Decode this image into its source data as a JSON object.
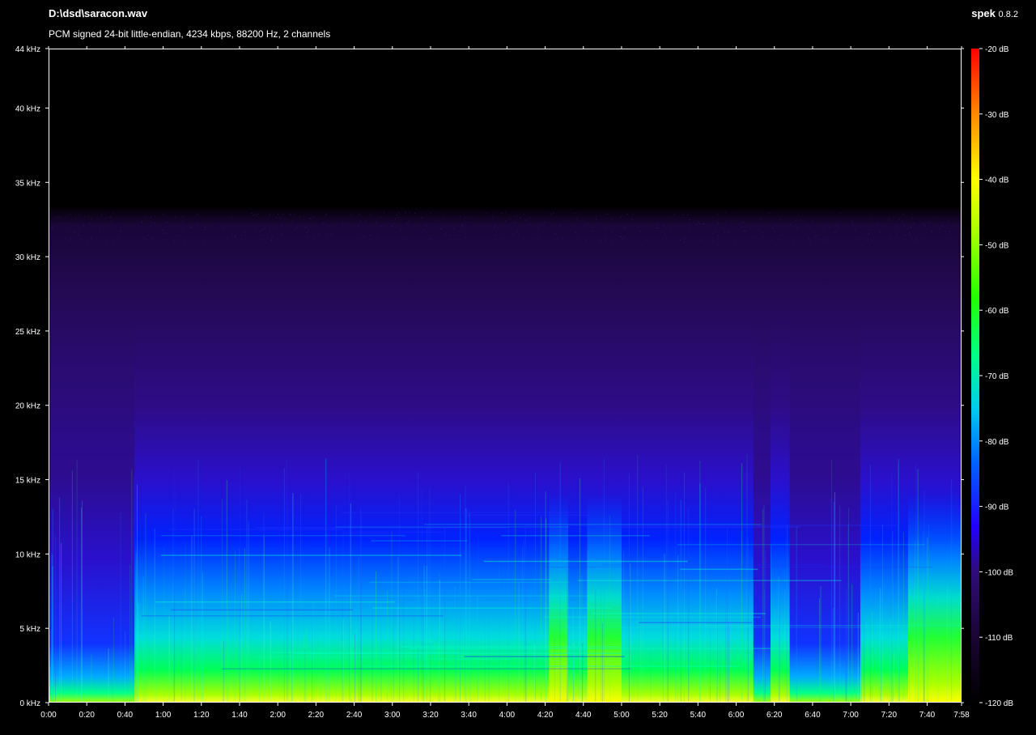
{
  "header": {
    "file_path": "D:\\dsd\\saracon.wav",
    "file_info": "PCM signed 24-bit little-endian, 4234 kbps, 88200 Hz, 2 channels",
    "app_name": "spek",
    "app_version": "0.8.2"
  },
  "colors": {
    "background": "#000000",
    "axis": "#ffffff",
    "palette": [
      "#000000",
      "#1a0533",
      "#2a0a66",
      "#3311aa",
      "#2200ff",
      "#0044ff",
      "#00aaff",
      "#00ffcc",
      "#00ff44",
      "#44ff00",
      "#ffff00",
      "#ff8800",
      "#ff0000"
    ]
  },
  "chart_data": {
    "type": "heatmap",
    "title": "",
    "xlabel": "",
    "ylabel": "",
    "x_ticks": [
      "0:00",
      "0:20",
      "0:40",
      "1:00",
      "1:20",
      "1:40",
      "2:00",
      "2:20",
      "2:40",
      "3:00",
      "3:20",
      "3:40",
      "4:00",
      "4:20",
      "4:40",
      "5:00",
      "5:20",
      "5:40",
      "6:00",
      "6:20",
      "6:40",
      "7:00",
      "7:20",
      "7:40",
      "7:58"
    ],
    "x_tick_seconds": [
      0,
      20,
      40,
      60,
      80,
      100,
      120,
      140,
      160,
      180,
      200,
      220,
      240,
      260,
      280,
      300,
      320,
      340,
      360,
      380,
      400,
      420,
      440,
      460,
      478
    ],
    "xlim_seconds": [
      0,
      478
    ],
    "y_ticks": [
      "0 kHz",
      "5 kHz",
      "10 kHz",
      "15 kHz",
      "20 kHz",
      "25 kHz",
      "30 kHz",
      "35 kHz",
      "40 kHz",
      "44 kHz"
    ],
    "y_tick_khz": [
      0,
      5,
      10,
      15,
      20,
      25,
      30,
      35,
      40,
      44
    ],
    "ylim_khz": [
      0,
      44
    ],
    "colorbar_ticks": [
      "-20 dB",
      "-30 dB",
      "-40 dB",
      "-50 dB",
      "-60 dB",
      "-70 dB",
      "-80 dB",
      "-90 dB",
      "-100 dB",
      "-110 dB",
      "-120 dB"
    ],
    "colorbar_db": [
      -20,
      -30,
      -40,
      -50,
      -60,
      -70,
      -80,
      -90,
      -100,
      -110,
      -120
    ],
    "colorbar_range_db": [
      -120,
      -20
    ],
    "noise_floor_khz": 33,
    "quiet_segments_seconds": [
      [
        0,
        45
      ],
      [
        369,
        378
      ],
      [
        388,
        425
      ]
    ],
    "loud_segments_seconds": [
      [
        262,
        272
      ],
      [
        282,
        300
      ],
      [
        450,
        478
      ]
    ]
  }
}
